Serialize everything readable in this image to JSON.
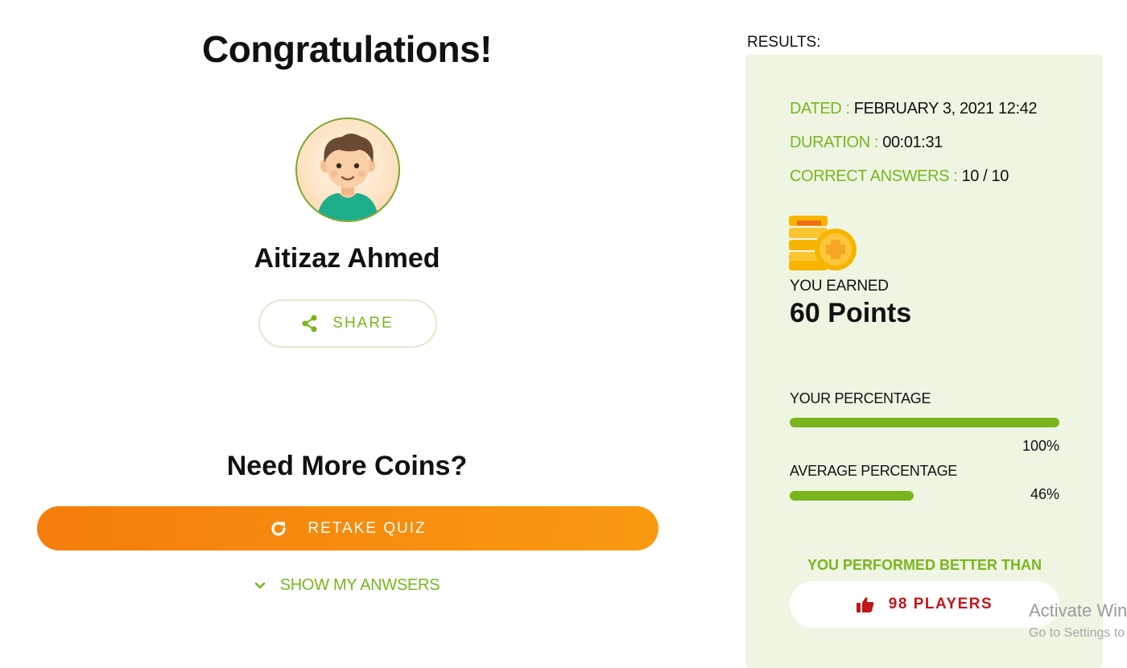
{
  "header": {
    "title": "Congratulations!"
  },
  "profile": {
    "name": "Aitizaz Ahmed",
    "share_label": "SHARE",
    "avatar_icon": "boy-avatar-icon"
  },
  "coins": {
    "heading": "Need More Coins?",
    "retake_label": "RETAKE QUIZ",
    "retake_icon": "refresh-icon",
    "show_answers_label": "SHOW MY ANWSERS",
    "show_answers_icon": "chevron-down-icon"
  },
  "results": {
    "caption": "RESULTS:",
    "dated_key": "DATED : ",
    "dated_value": "FEBRUARY 3, 2021 12:42",
    "duration_key": "DURATION : ",
    "duration_value": "00:01:31",
    "correct_key": "CORRECT ANSWERS : ",
    "correct_value": "10 / 10",
    "coins_icon": "coins-icon",
    "earned_label": "YOU EARNED",
    "earned_value": "60 Points",
    "your_pct_label": "YOUR PERCENTAGE",
    "your_pct_text": "100%",
    "your_pct_fraction": 1.0,
    "avg_pct_label": "AVERAGE PERCENTAGE",
    "avg_pct_text": "46%",
    "avg_pct_fraction": 0.46,
    "better_label": "YOU PERFORMED BETTER THAN",
    "players_label": "98 PLAYERS",
    "players_icon": "thumbs-up-icon"
  },
  "watermark": {
    "title": "Activate Win",
    "subtitle": "Go to Settings to"
  },
  "colors": {
    "accent_green": "#7ab51d",
    "panel_bg": "#eef6e3",
    "orange": "#f57d0c",
    "red": "#c0161c"
  }
}
